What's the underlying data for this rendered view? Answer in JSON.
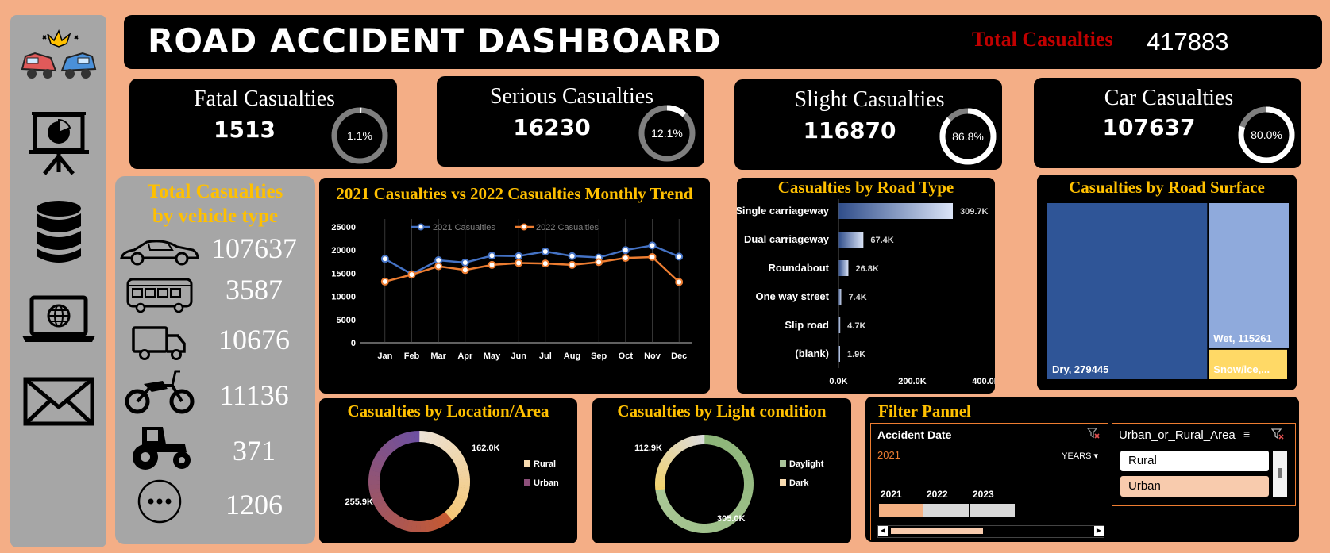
{
  "header": {
    "title": "ROAD ACCIDENT DASHBOARD",
    "total_label": "Total Casualties",
    "total_value": "417883"
  },
  "sidebar": {
    "items": [
      "car-crash-icon",
      "presentation-chart-icon",
      "database-icon",
      "laptop-globe-icon",
      "mail-icon"
    ]
  },
  "kpis": [
    {
      "label": "Fatal Casualties",
      "value": "1513",
      "pct_label": "1.1%",
      "pct": 1.1
    },
    {
      "label": "Serious Casualties",
      "value": "16230",
      "pct_label": "12.1%",
      "pct": 12.1
    },
    {
      "label": "Slight Casualties",
      "value": "116870",
      "pct_label": "86.8%",
      "pct": 86.8
    },
    {
      "label": "Car Casualties",
      "value": "107637",
      "pct_label": "80.0%",
      "pct": 80.0
    }
  ],
  "vehicle_panel": {
    "title_line1": "Total Casualties",
    "title_line2": "by vehicle type",
    "items": [
      {
        "icon": "car-icon",
        "value": "107637"
      },
      {
        "icon": "bus-icon",
        "value": "3587"
      },
      {
        "icon": "truck-icon",
        "value": "10676"
      },
      {
        "icon": "motorcycle-icon",
        "value": "11136"
      },
      {
        "icon": "tractor-icon",
        "value": "371"
      },
      {
        "icon": "more-icon",
        "value": "1206"
      }
    ]
  },
  "filter": {
    "title": "Filter Pannel",
    "date_slicer": {
      "title": "Accident Date",
      "selected": "2021",
      "level": "YEARS",
      "years": [
        "2021",
        "2022",
        "2023"
      ]
    },
    "area_slicer": {
      "title": "Urban_or_Rural_Area",
      "options": [
        "Rural",
        "Urban"
      ]
    }
  },
  "colors": {
    "accent": "#ffc000",
    "line2021": "#4472c4",
    "line2022": "#ed7d31",
    "panel": "#000000",
    "background": "#f4ae86",
    "total_label": "#c00000"
  },
  "chart_data": [
    {
      "type": "line",
      "title": "2021 Casualties vs 2022 Casualties Monthly Trend",
      "categories": [
        "Jan",
        "Feb",
        "Mar",
        "Apr",
        "May",
        "Jun",
        "Jul",
        "Aug",
        "Sep",
        "Oct",
        "Nov",
        "Dec"
      ],
      "series": [
        {
          "name": "2021 Casualties",
          "values": [
            18100,
            14800,
            17800,
            17300,
            18800,
            18700,
            19700,
            18700,
            18400,
            20000,
            21000,
            18600
          ]
        },
        {
          "name": "2022 Casualties",
          "values": [
            13200,
            14700,
            16500,
            15700,
            16800,
            17200,
            17100,
            16800,
            17400,
            18300,
            18500,
            13100
          ]
        }
      ],
      "yticks": [
        "0",
        "5000",
        "10000",
        "15000",
        "20000",
        "25000"
      ],
      "ylim": [
        0,
        25000
      ],
      "legend": "top"
    },
    {
      "type": "bar",
      "orientation": "horizontal",
      "title": "Casualties by Road Type",
      "categories": [
        "Single carriageway",
        "Dual carriageway",
        "Roundabout",
        "One way street",
        "Slip road",
        "(blank)"
      ],
      "values": [
        309700,
        67400,
        26800,
        7400,
        4700,
        1900
      ],
      "labels": [
        "309.7K",
        "67.4K",
        "26.8K",
        "7.4K",
        "4.7K",
        "1.9K"
      ],
      "xticks": [
        "0.0K",
        "200.0K",
        "400.0K"
      ],
      "xlim": [
        0,
        400000
      ]
    },
    {
      "type": "treemap",
      "title": "Casualties by Road Surface",
      "items": [
        {
          "label": "Dry, 279445",
          "value": 279445,
          "color": "#2f5597"
        },
        {
          "label": "Wet, 115261",
          "value": 115261,
          "color": "#8faadc"
        },
        {
          "label": "Snow/ice,...",
          "value": 23177,
          "color": "#ffd966"
        }
      ]
    },
    {
      "type": "pie",
      "title": "Casualties by Location/Area",
      "slices": [
        {
          "name": "Rural",
          "value": 162000,
          "label": "162.0K"
        },
        {
          "name": "Urban",
          "value": 255900,
          "label": "255.9K"
        }
      ]
    },
    {
      "type": "pie",
      "title": "Casualties by Light condition",
      "slices": [
        {
          "name": "Daylight",
          "value": 305000,
          "label": "305.0K"
        },
        {
          "name": "Dark",
          "value": 112900,
          "label": "112.9K"
        }
      ]
    }
  ]
}
